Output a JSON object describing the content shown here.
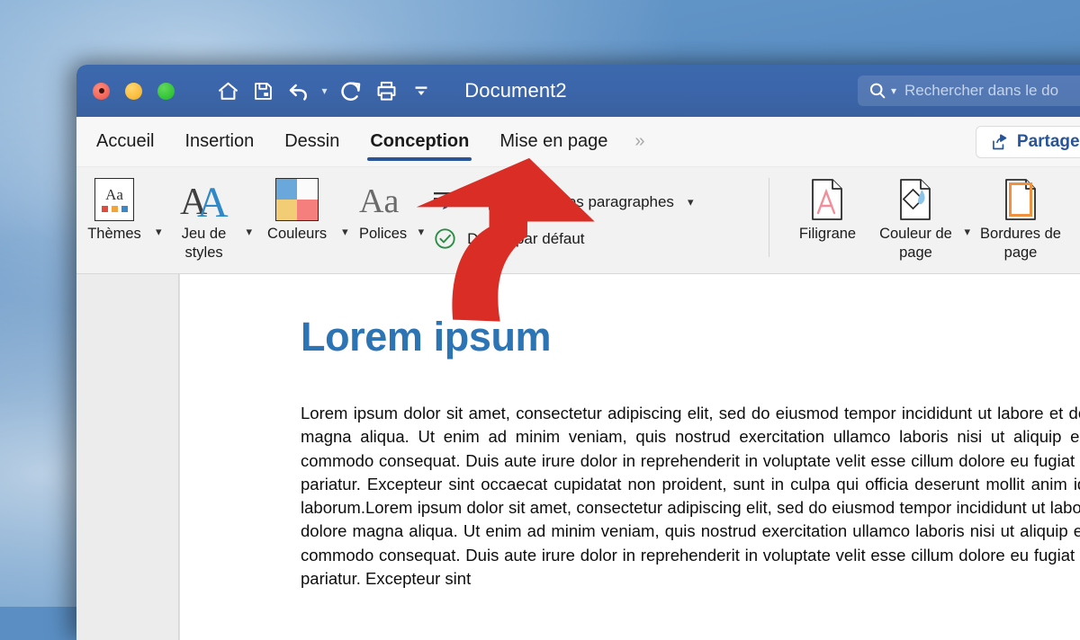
{
  "window": {
    "title": "Document2",
    "traffic_lights": [
      "close-red",
      "minimize-yellow",
      "maximize-green"
    ]
  },
  "quick_access": [
    {
      "name": "home-icon",
      "label": "Accueil"
    },
    {
      "name": "save-icon",
      "label": "Enregistrer"
    },
    {
      "name": "undo-icon",
      "label": "Annuler"
    },
    {
      "name": "redo-icon",
      "label": "Rétablir"
    },
    {
      "name": "print-icon",
      "label": "Imprimer"
    },
    {
      "name": "customize-toolbar-icon",
      "label": "Personnaliser"
    }
  ],
  "search": {
    "placeholder": "Rechercher dans le do",
    "icon": "search-icon"
  },
  "tabs": [
    {
      "label": "Accueil",
      "active": false
    },
    {
      "label": "Insertion",
      "active": false
    },
    {
      "label": "Dessin",
      "active": false
    },
    {
      "label": "Conception",
      "active": true
    },
    {
      "label": "Mise en page",
      "active": false
    }
  ],
  "overflow_label": "»",
  "share": {
    "label": "Partager",
    "icon": "share-icon"
  },
  "ribbon": {
    "group_left": [
      {
        "label": "Thèmes",
        "icon": "themes-icon",
        "has_dropdown": true
      },
      {
        "label": "Jeu de styles",
        "icon": "style-set-icon",
        "has_dropdown": true
      },
      {
        "label": "Couleurs",
        "icon": "colors-swatch-icon",
        "has_dropdown": true
      },
      {
        "label": "Polices",
        "icon": "fonts-icon",
        "has_dropdown": true
      }
    ],
    "group_paragraph": [
      {
        "label": "Espacement des paragraphes",
        "icon": "paragraph-spacing-icon",
        "has_dropdown": true
      },
      {
        "label": "Définir par défaut",
        "icon": "set-default-check-icon",
        "has_dropdown": false
      }
    ],
    "group_page": [
      {
        "label": "Filigrane",
        "icon": "watermark-icon",
        "has_dropdown": false
      },
      {
        "label": "Couleur de page",
        "icon": "page-color-icon",
        "has_dropdown": true
      },
      {
        "label": "Bordures de page",
        "icon": "page-borders-icon",
        "has_dropdown": false
      }
    ]
  },
  "document": {
    "heading": "Lorem ipsum",
    "body": "Lorem ipsum dolor sit amet, consectetur adipiscing elit, sed do eiusmod tempor incididunt ut labore et dolore magna aliqua. Ut enim ad minim veniam, quis nostrud exercitation ullamco laboris nisi ut aliquip ex ea commodo consequat. Duis aute irure dolor in reprehenderit in voluptate velit esse cillum dolore eu fugiat nulla pariatur. Excepteur sint occaecat cupidatat non proident, sunt in culpa qui officia deserunt mollit anim id est laborum.Lorem ipsum dolor sit amet, consectetur adipiscing elit, sed do eiusmod tempor incididunt ut labore et dolore magna aliqua. Ut enim ad minim veniam, quis nostrud exercitation ullamco laboris nisi ut aliquip ex ea commodo consequat. Duis aute irure dolor in reprehenderit in voluptate velit esse cillum dolore eu fugiat nulla pariatur. Excepteur sint"
  },
  "annotation": {
    "type": "curved-arrow",
    "color": "#d92d26",
    "points_to": "Conception"
  },
  "colors": {
    "titlebar": "#3c66ab",
    "tab_active_underline": "#2a5699",
    "heading": "#2d74b5",
    "share_text": "#27559c",
    "annotation_arrow": "#d92d26",
    "ribbon_background": "#f2f2f2"
  }
}
